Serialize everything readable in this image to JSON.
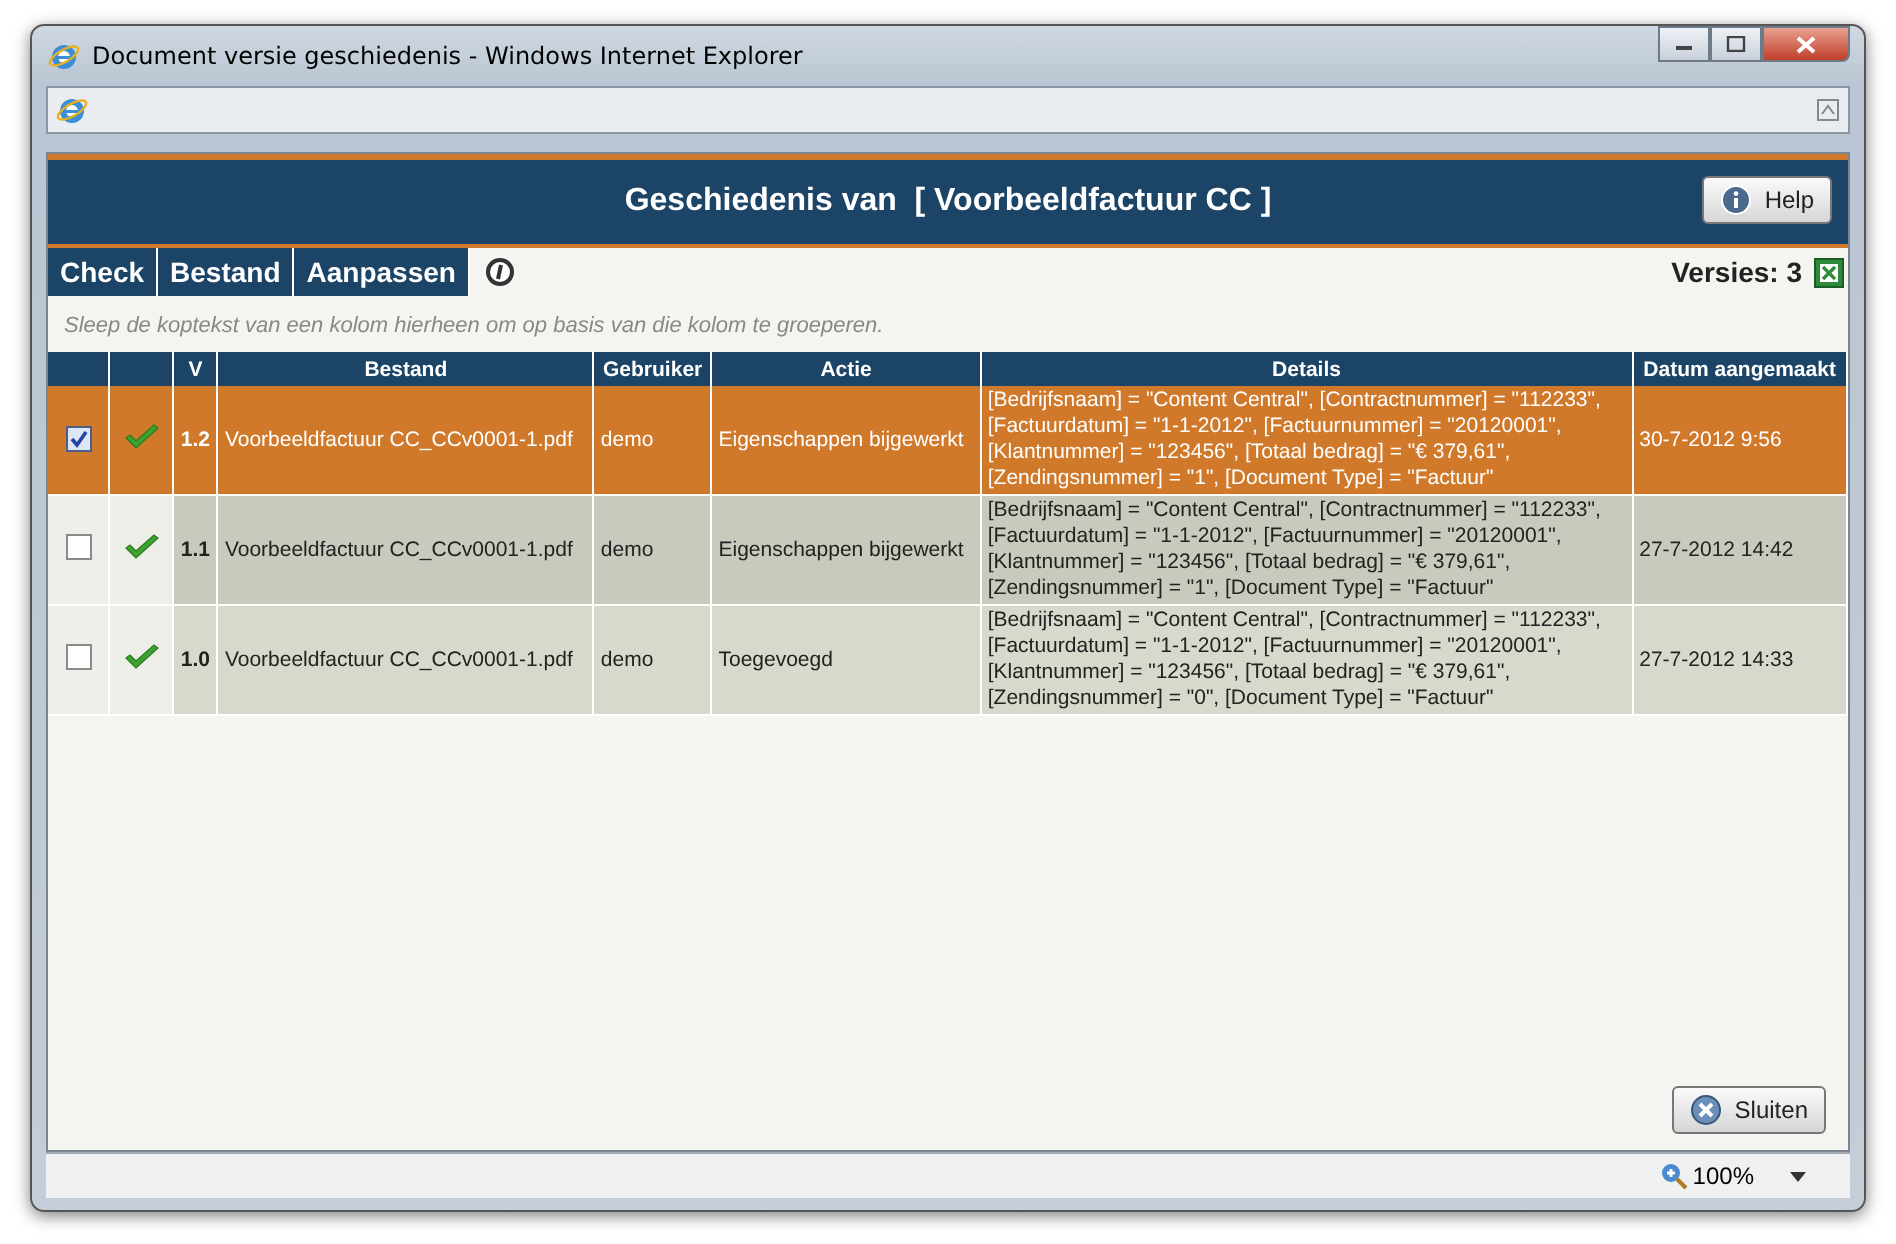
{
  "window": {
    "title": "Document versie geschiedenis - Windows Internet Explorer"
  },
  "header": {
    "title": "Geschiedenis van  [ Voorbeeldfactuur CC ]",
    "help_button": "Help"
  },
  "tabs": [
    {
      "label": "Check"
    },
    {
      "label": "Bestand"
    },
    {
      "label": "Aanpassen"
    }
  ],
  "versions_count": "Versies: 3",
  "group_hint": "Sleep de koptekst van een kolom hierheen om op basis van die kolom te groeperen.",
  "table": {
    "columns": [
      "V",
      "Bestand",
      "Gebruiker",
      "Actie",
      "Details",
      "Datum aangemaakt"
    ],
    "rows": [
      {
        "selected": true,
        "checked": true,
        "version": "1.2",
        "file": "Voorbeeldfactuur CC_CCv0001-1.pdf",
        "user": "demo",
        "action": "Eigenschappen bijgewerkt",
        "details": [
          "[Bedrijfsnaam] = \"Content Central\", [Contractnummer] = \"112233\",",
          "[Factuurdatum] = \"1-1-2012\", [Factuurnummer] = \"20120001\",",
          "[Klantnummer] = \"123456\", [Totaal bedrag] = \"€ 379,61\",",
          "[Zendingsnummer] = \"1\", [Document Type] = \"Factuur\""
        ],
        "date": "30-7-2012 9:56"
      },
      {
        "selected": false,
        "checked": false,
        "version": "1.1",
        "file": "Voorbeeldfactuur CC_CCv0001-1.pdf",
        "user": "demo",
        "action": "Eigenschappen bijgewerkt",
        "details": [
          "[Bedrijfsnaam] = \"Content Central\", [Contractnummer] = \"112233\",",
          "[Factuurdatum] = \"1-1-2012\", [Factuurnummer] = \"20120001\",",
          "[Klantnummer] = \"123456\", [Totaal bedrag] = \"€ 379,61\",",
          "[Zendingsnummer] = \"1\", [Document Type] = \"Factuur\""
        ],
        "date": "27-7-2012 14:42"
      },
      {
        "selected": false,
        "checked": false,
        "version": "1.0",
        "file": "Voorbeeldfactuur CC_CCv0001-1.pdf",
        "user": "demo",
        "action": "Toegevoegd",
        "details": [
          "[Bedrijfsnaam] = \"Content Central\", [Contractnummer] = \"112233\",",
          "[Factuurdatum] = \"1-1-2012\", [Factuurnummer] = \"20120001\",",
          "[Klantnummer] = \"123456\", [Totaal bedrag] = \"€ 379,61\",",
          "[Zendingsnummer] = \"0\", [Document Type] = \"Factuur\""
        ],
        "date": "27-7-2012 14:33"
      }
    ]
  },
  "close_button": "Sluiten",
  "status_bar": {
    "zoom": "100%"
  }
}
